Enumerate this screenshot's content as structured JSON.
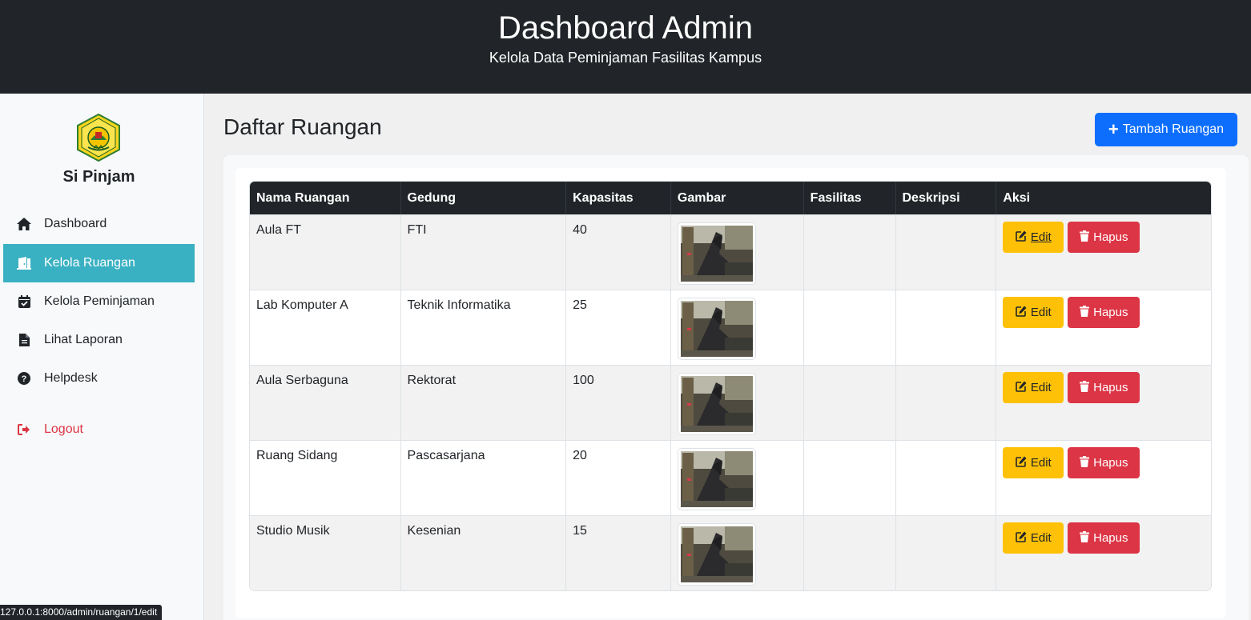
{
  "header": {
    "title": "Dashboard Admin",
    "subtitle": "Kelola Data Peminjaman Fasilitas Kampus"
  },
  "sidebar": {
    "brand": "Si Pinjam",
    "items": [
      {
        "label": "Dashboard",
        "icon": "home-icon"
      },
      {
        "label": "Kelola Ruangan",
        "icon": "door-icon",
        "active": true
      },
      {
        "label": "Kelola Peminjaman",
        "icon": "calendar-check-icon"
      },
      {
        "label": "Lihat Laporan",
        "icon": "file-icon"
      },
      {
        "label": "Helpdesk",
        "icon": "question-circle-icon"
      }
    ],
    "logout": {
      "label": "Logout",
      "icon": "sign-out-icon"
    }
  },
  "main": {
    "title": "Daftar Ruangan",
    "add_button": "Tambah Ruangan"
  },
  "table": {
    "columns": [
      "Nama Ruangan",
      "Gedung",
      "Kapasitas",
      "Gambar",
      "Fasilitas",
      "Deskripsi",
      "Aksi"
    ],
    "rows": [
      {
        "nama": "Aula FT",
        "gedung": "FTI",
        "kapasitas": "40",
        "fasilitas": "",
        "deskripsi": ""
      },
      {
        "nama": "Lab Komputer A",
        "gedung": "Teknik Informatika",
        "kapasitas": "25",
        "fasilitas": "",
        "deskripsi": ""
      },
      {
        "nama": "Aula Serbaguna",
        "gedung": "Rektorat",
        "kapasitas": "100",
        "fasilitas": "",
        "deskripsi": ""
      },
      {
        "nama": "Ruang Sidang",
        "gedung": "Pascasarjana",
        "kapasitas": "20",
        "fasilitas": "",
        "deskripsi": ""
      },
      {
        "nama": "Studio Musik",
        "gedung": "Kesenian",
        "kapasitas": "15",
        "fasilitas": "",
        "deskripsi": ""
      }
    ],
    "edit_label": "Edit",
    "delete_label": "Hapus"
  },
  "status_url": "127.0.0.1:8000/admin/ruangan/1/edit",
  "colors": {
    "header_bg": "#212529",
    "active_nav": "#3ab1c2",
    "primary": "#0d6efd",
    "warning": "#ffc107",
    "danger": "#dc3545"
  }
}
